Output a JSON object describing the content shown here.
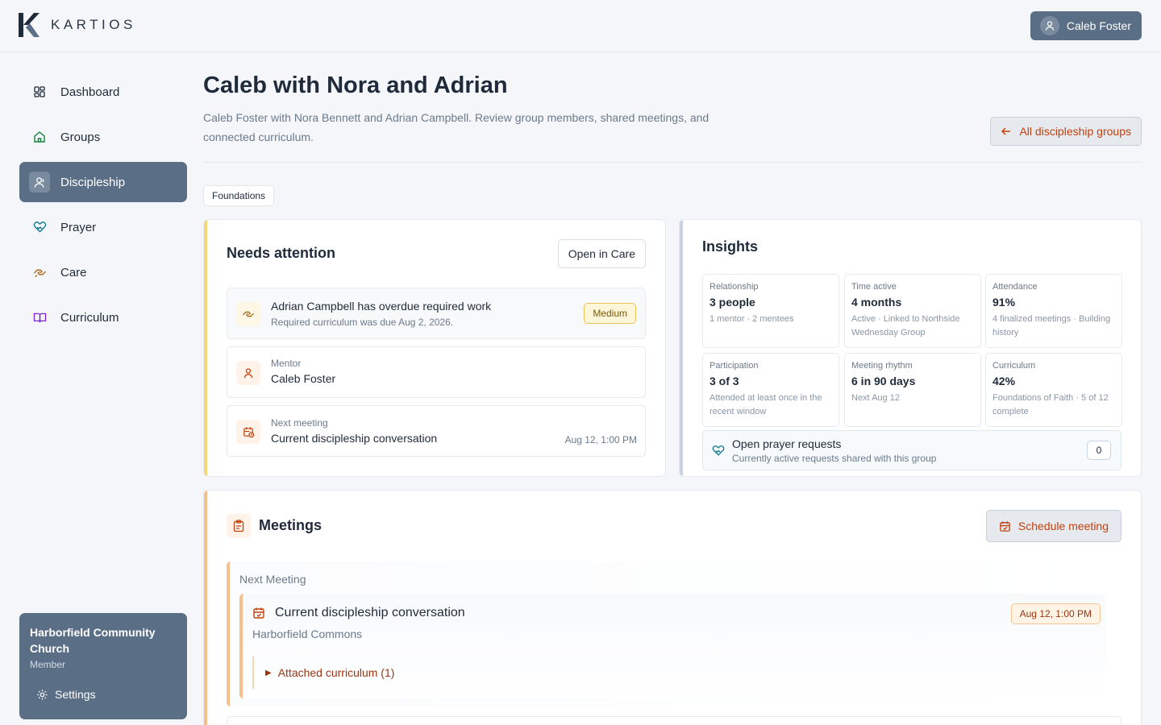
{
  "app": {
    "brand": "KARTIOS",
    "user_name": "Caleb Foster"
  },
  "sidebar": {
    "items": [
      {
        "label": "Dashboard",
        "icon": "dashboard-icon"
      },
      {
        "label": "Groups",
        "icon": "home-icon"
      },
      {
        "label": "Discipleship",
        "icon": "user-icon",
        "active": true
      },
      {
        "label": "Prayer",
        "icon": "heart-hands-icon"
      },
      {
        "label": "Care",
        "icon": "handshake-icon"
      },
      {
        "label": "Curriculum",
        "icon": "book-icon"
      }
    ],
    "org": {
      "name": "Harborfield Community Church",
      "role": "Member",
      "settings_label": "Settings"
    }
  },
  "header": {
    "title": "Caleb with Nora and Adrian",
    "description": "Caleb Foster with Nora Bennett and Adrian Campbell. Review group members, shared meetings, and connected curriculum.",
    "back_label": "All discipleship groups",
    "tag": "Foundations"
  },
  "needs_attention": {
    "title": "Needs attention",
    "open_care_label": "Open in Care",
    "alert": {
      "title": "Adrian Campbell has overdue required work",
      "subtitle": "Required curriculum was due Aug 2, 2026.",
      "badge": "Medium"
    },
    "mentor": {
      "label": "Mentor",
      "value": "Caleb Foster"
    },
    "next_meeting": {
      "label": "Next meeting",
      "value": "Current discipleship conversation",
      "when": "Aug 12, 1:00 PM"
    }
  },
  "insights": {
    "title": "Insights",
    "stats": [
      {
        "label": "Relationship",
        "value": "3 people",
        "sub": "1 mentor · 2 mentees"
      },
      {
        "label": "Time active",
        "value": "4 months",
        "sub": "Active · Linked to Northside Wednesday Group"
      },
      {
        "label": "Attendance",
        "value": "91%",
        "sub": "4 finalized meetings · Building history"
      },
      {
        "label": "Participation",
        "value": "3 of 3",
        "sub": "Attended at least once in the recent window"
      },
      {
        "label": "Meeting rhythm",
        "value": "6 in 90 days",
        "sub": "Next Aug 12"
      },
      {
        "label": "Curriculum",
        "value": "42%",
        "sub": "Foundations of Faith · 5 of 12 complete"
      }
    ],
    "prayer": {
      "title": "Open prayer requests",
      "subtitle": "Currently active requests shared with this group",
      "count": "0"
    }
  },
  "meetings": {
    "title": "Meetings",
    "schedule_label": "Schedule meeting",
    "next_label": "Next Meeting",
    "next": {
      "title": "Current discipleship conversation",
      "location": "Harborfield Commons",
      "date": "Aug 12, 1:00 PM",
      "curriculum_label": "Attached curriculum (1)"
    }
  },
  "colors": {
    "primary": "#5a6e85",
    "accent_orange": "#c2410c",
    "warning_accent": "#f5d77a",
    "meeting_accent": "#f6c08c",
    "insights_accent": "#c9d3de"
  }
}
